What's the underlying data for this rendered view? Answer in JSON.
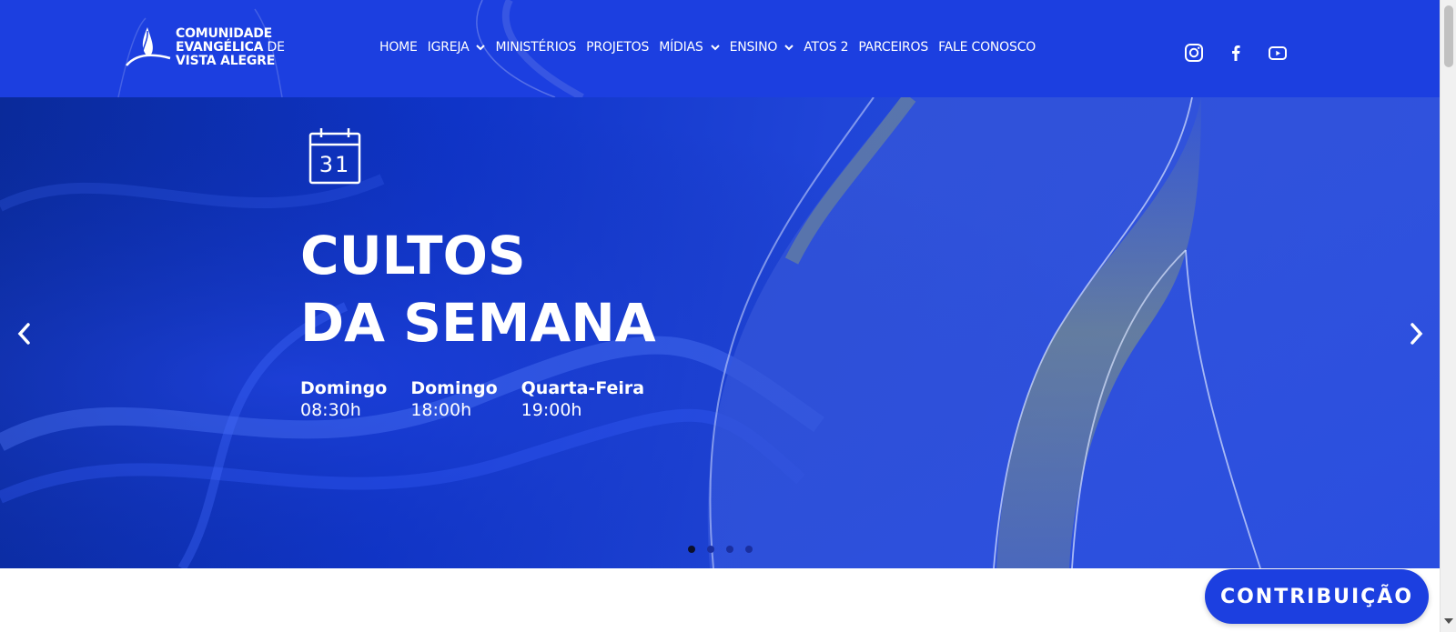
{
  "logo": {
    "line1": "COMUNIDADE",
    "line2_bold": "EVANGÉLICA",
    "line2_thin": " DE",
    "line3": "VISTA ALEGRE"
  },
  "nav": {
    "items": [
      {
        "label": "HOME",
        "dropdown": false
      },
      {
        "label": "IGREJA",
        "dropdown": true
      },
      {
        "label": "MINISTÉRIOS",
        "dropdown": false
      },
      {
        "label": "PROJETOS",
        "dropdown": false
      },
      {
        "label": "MÍDIAS",
        "dropdown": true
      },
      {
        "label": "ENSINO",
        "dropdown": true
      },
      {
        "label": "ATOS 2",
        "dropdown": false
      },
      {
        "label": "PARCEIROS",
        "dropdown": false
      },
      {
        "label": "FALE CONOSCO",
        "dropdown": false
      }
    ]
  },
  "social": [
    "instagram-icon",
    "facebook-icon",
    "youtube-icon"
  ],
  "hero": {
    "calendar_day": "31",
    "title_line1": "CULTOS",
    "title_line2": "DA SEMANA",
    "schedule": [
      {
        "day": "Domingo",
        "time": "08:30h"
      },
      {
        "day": "Domingo",
        "time": "18:00h"
      },
      {
        "day": "Quarta-Feira",
        "time": "19:00h"
      }
    ],
    "slide_count": 4,
    "active_slide": 1
  },
  "cta": {
    "label": "CONTRIBUIÇÃO"
  },
  "colors": {
    "brand_blue": "#1c3fe0",
    "dark_blue": "#0a2a9a",
    "accent_gold": "#8fa070"
  }
}
